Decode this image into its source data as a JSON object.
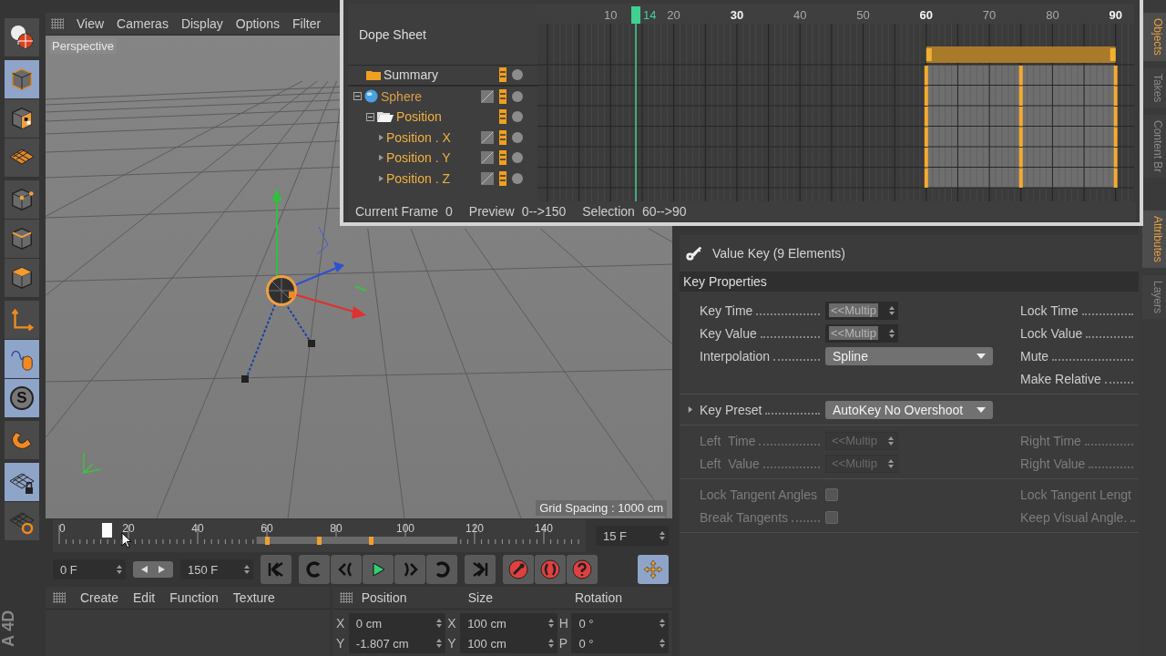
{
  "left_toolbar": [
    {
      "kind": "camera-globe",
      "selected": false
    },
    {
      "kind": "cube",
      "selected": true
    },
    {
      "kind": "checker-cube",
      "selected": false
    },
    {
      "kind": "grid-plane",
      "selected": false
    },
    {
      "kind": "points-cube",
      "selected": false
    },
    {
      "kind": "edges-cube",
      "selected": false
    },
    {
      "kind": "polygons-cube",
      "selected": false
    },
    {
      "kind": "axis",
      "selected": false
    },
    {
      "kind": "mouse",
      "selected": true
    },
    {
      "kind": "snap",
      "selected": true,
      "label": "S"
    },
    {
      "kind": "magnet",
      "selected": false
    },
    {
      "kind": "grid-lock",
      "selected": true
    },
    {
      "kind": "grid-loop",
      "selected": false
    }
  ],
  "brand_text": "A 4D",
  "viewport_menu": [
    "View",
    "Cameras",
    "Display",
    "Options",
    "Filter"
  ],
  "viewport": {
    "label": "Perspective",
    "grid_spacing": "Grid Spacing : 1000 cm"
  },
  "timeline": {
    "labels": [
      "0",
      "20",
      "40",
      "60",
      "80",
      "100",
      "120",
      "140"
    ],
    "playhead": {
      "level": 0.093
    },
    "fps_field": "15 F"
  },
  "transport": {
    "start_field": "0 F",
    "end_field": "150 F",
    "move_tool": {
      "selected": true
    }
  },
  "materials_menu": [
    "Create",
    "Edit",
    "Function",
    "Texture"
  ],
  "coordinates": {
    "headers": [
      "Position",
      "Size",
      "Rotation"
    ],
    "rows": [
      [
        {
          "axis": "X",
          "value": "0 cm"
        },
        {
          "axis": "X",
          "value": "100 cm"
        },
        {
          "axis": "H",
          "value": "0 °"
        }
      ],
      [
        {
          "axis": "Y",
          "value": "-1.807 cm"
        },
        {
          "axis": "Y",
          "value": "100 cm"
        },
        {
          "axis": "P",
          "value": "0 °"
        }
      ]
    ]
  },
  "dope_sheet": {
    "title": "Dope Sheet",
    "ruler": [
      "10",
      "20",
      "30",
      "40",
      "50",
      "60",
      "70",
      "80",
      "90"
    ],
    "current_frame": "14",
    "tracks": [
      {
        "kind": "summary",
        "name": "Summary"
      },
      {
        "kind": "object",
        "name": "Sphere",
        "expanded": true,
        "children": [
          {
            "kind": "folder",
            "name": "Position",
            "expanded": true,
            "children": [
              {
                "kind": "track",
                "name": "Position . X"
              },
              {
                "kind": "track",
                "name": "Position . Y"
              },
              {
                "kind": "track",
                "name": "Position . Z"
              }
            ]
          }
        ]
      }
    ],
    "status": [
      {
        "label": "Current Frame",
        "value": "0"
      },
      {
        "label": "Preview",
        "value": "0-->150"
      },
      {
        "label": "Selection",
        "value": "60-->90"
      }
    ]
  },
  "attributes": {
    "title": "Value Key (9 Elements)",
    "section": "Key Properties",
    "groups": [
      {
        "disabled": false,
        "rows": [
          {
            "label": "Key Time",
            "control": {
              "kind": "spinner",
              "value": "<<Multip"
            },
            "right_label": "Lock Time"
          },
          {
            "label": "Key Value",
            "control": {
              "kind": "spinner",
              "value": "<<Multip"
            },
            "right_label": "Lock Value"
          },
          {
            "label": "Interpolation",
            "control": {
              "kind": "dropdown",
              "value": "Spline"
            },
            "right_label": "Mute"
          },
          {
            "right_label": "Make Relative"
          }
        ]
      },
      {
        "disabled": false,
        "rows": [
          {
            "label": "Key Preset",
            "expanded": false,
            "control": {
              "kind": "dropdown",
              "value": "AutoKey No Overshoot"
            }
          }
        ]
      },
      {
        "disabled": true,
        "rows": [
          {
            "label": "Left  Time",
            "control": {
              "kind": "spinner",
              "value": "<<Multip"
            },
            "right_label": "Right Time"
          },
          {
            "label": "Left  Value",
            "control": {
              "kind": "spinner",
              "value": "<<Multip"
            },
            "right_label": "Right Value"
          }
        ]
      },
      {
        "disabled": true,
        "rows": [
          {
            "label": "Lock Tangent Angles",
            "control": {
              "kind": "checkbox",
              "checked": false
            },
            "right_label": "Lock Tangent Lengt"
          },
          {
            "label": "Break Tangents",
            "control": {
              "kind": "checkbox",
              "checked": false
            },
            "right_label": "Keep Visual Angle."
          }
        ]
      }
    ]
  },
  "side_tabs": [
    {
      "label": "Objects",
      "selected": true
    },
    {
      "label": "Takes",
      "selected": false
    },
    {
      "label": "Content Br",
      "selected": false
    },
    {
      "label": "Attributes",
      "selected": true
    },
    {
      "label": "Layers",
      "selected": false
    }
  ]
}
